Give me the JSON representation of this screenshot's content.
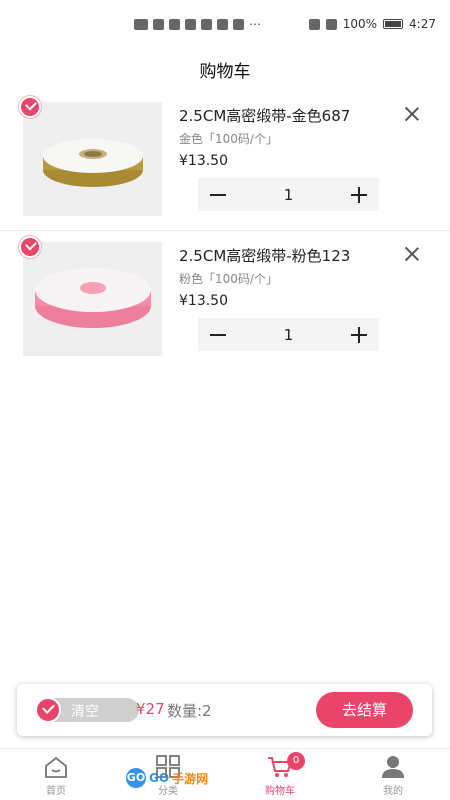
{
  "status_bar": {
    "battery": "100%",
    "time": "4:27",
    "more": "⋯"
  },
  "page_title": "购物车",
  "cart_items": [
    {
      "name": "2.5CM高密缎带-金色687",
      "spec": "金色「100码/个」",
      "price": "¥13.50",
      "quantity": "1",
      "ribbon_color": "#b89a3f",
      "checked": true
    },
    {
      "name": "2.5CM高密缎带-粉色123",
      "spec": "粉色「100码/个」",
      "price": "¥13.50",
      "quantity": "1",
      "ribbon_color": "#f28ea9",
      "checked": true
    }
  ],
  "action_bar": {
    "clear_label": "清空",
    "total": "¥27",
    "count_label": "数量:2",
    "checkout_label": "去结算"
  },
  "tabs": [
    {
      "label": "首页",
      "icon": "home-icon"
    },
    {
      "label": "分类",
      "icon": "grid-icon"
    },
    {
      "label": "购物车",
      "icon": "cart-icon",
      "badge": "0",
      "active": true
    },
    {
      "label": "我的",
      "icon": "user-icon"
    }
  ],
  "watermark": {
    "part1": "GO",
    "part2": "GO",
    "part3": "手游网"
  },
  "colors": {
    "accent": "#e9446a",
    "stepper_bg": "#f4f4f4",
    "muted": "#888888"
  }
}
